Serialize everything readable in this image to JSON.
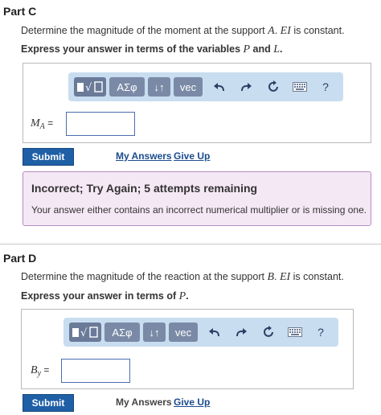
{
  "colors": {
    "accent": "#1f5fa6",
    "toolbar": "#c9ddf1",
    "feedback_bg": "#f5e8f5"
  },
  "partC": {
    "title": "Part C",
    "question_pre": "Determine the magnitude of the moment at the support ",
    "question_var1": "A",
    "question_mid": ". ",
    "question_var2": "EI",
    "question_post": " is constant.",
    "instruction_pre": "Express your answer in terms of the variables ",
    "instruction_var1": "P",
    "instruction_mid": " and ",
    "instruction_var2": "L",
    "instruction_post": ".",
    "toolbar": {
      "templates_icon": "templates-icon",
      "greek": "ΑΣφ",
      "arrows": "↓↑",
      "vec": "vec",
      "help": "?"
    },
    "answer_label_main": "M",
    "answer_label_sub": "A",
    "answer_label_eq": " =",
    "submit": "Submit",
    "my_answers": "My Answers",
    "give_up": "Give Up",
    "feedback_title": "Incorrect; Try Again; 5 attempts remaining",
    "feedback_text": "Your answer either contains an incorrect numerical multiplier or is missing one."
  },
  "partD": {
    "title": "Part D",
    "question_pre": "Determine the magnitude of the reaction at the support ",
    "question_var1": "B",
    "question_mid": ". ",
    "question_var2": "EI",
    "question_post": " is constant.",
    "instruction_pre": "Express your answer in terms of ",
    "instruction_var1": "P",
    "instruction_post": ".",
    "toolbar": {
      "greek": "ΑΣφ",
      "arrows": "↓↑",
      "vec": "vec",
      "help": "?"
    },
    "answer_label_main": "B",
    "answer_label_sub": "y",
    "answer_label_eq": " =",
    "submit": "Submit",
    "my_answers": "My Answers",
    "give_up": "Give Up"
  }
}
